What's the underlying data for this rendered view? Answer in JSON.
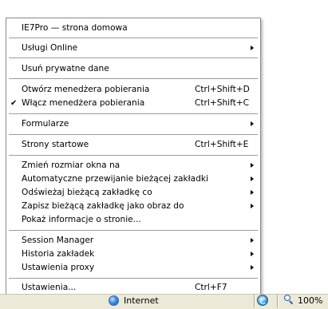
{
  "menu": {
    "items": [
      {
        "label": "IE7Pro — strona domowa",
        "shortcut": "",
        "submenu": false,
        "checked": false
      },
      {
        "label": "Usługi Online",
        "shortcut": "",
        "submenu": true,
        "checked": false
      },
      {
        "label": "Usuń prywatne dane",
        "shortcut": "",
        "submenu": false,
        "checked": false
      },
      {
        "label": "Otwórz menedżera pobierania",
        "shortcut": "Ctrl+Shift+D",
        "submenu": false,
        "checked": false
      },
      {
        "label": "Włącz menedżera pobierania",
        "shortcut": "Ctrl+Shift+C",
        "submenu": false,
        "checked": true
      },
      {
        "label": "Formularze",
        "shortcut": "",
        "submenu": true,
        "checked": false
      },
      {
        "label": "Strony startowe",
        "shortcut": "Ctrl+Shift+E",
        "submenu": false,
        "checked": false
      },
      {
        "label": "Zmień rozmiar okna na",
        "shortcut": "",
        "submenu": true,
        "checked": false
      },
      {
        "label": "Automatyczne przewijanie bieżącej zakładki",
        "shortcut": "",
        "submenu": true,
        "checked": false
      },
      {
        "label": "Odświeżaj bieżącą zakładkę co",
        "shortcut": "",
        "submenu": true,
        "checked": false
      },
      {
        "label": "Zapisz bieżącą zakładkę jako obraz do",
        "shortcut": "",
        "submenu": true,
        "checked": false
      },
      {
        "label": "Pokaż informacje o stronie...",
        "shortcut": "",
        "submenu": false,
        "checked": false
      },
      {
        "label": "Session Manager",
        "shortcut": "",
        "submenu": true,
        "checked": false
      },
      {
        "label": "Historia zakładek",
        "shortcut": "",
        "submenu": true,
        "checked": false
      },
      {
        "label": "Ustawienia proxy",
        "shortcut": "",
        "submenu": true,
        "checked": false
      },
      {
        "label": "Ustawienia...",
        "shortcut": "Ctrl+F7",
        "submenu": false,
        "checked": false
      }
    ],
    "check_glyph": "✔"
  },
  "statusbar": {
    "zone_label": "Internet",
    "zoom_label": "100%"
  }
}
